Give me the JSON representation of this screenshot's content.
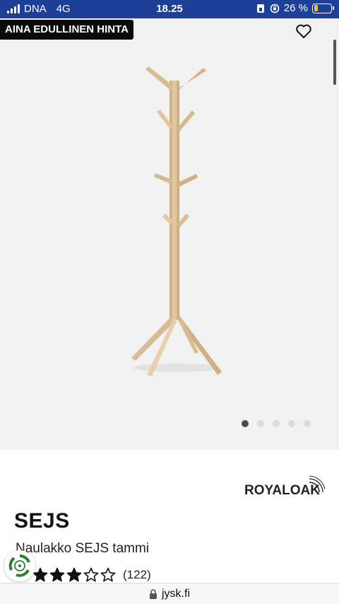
{
  "status_bar": {
    "carrier": "DNA",
    "network": "4G",
    "time": "18.25",
    "battery_percent_text": "26 %",
    "battery_level": 0.26,
    "battery_color": "#f5c400",
    "background_color": "#1d3f97"
  },
  "product_image": {
    "promo_badge": "AINA EDULLINEN HINTA",
    "favorite_icon": "heart-outline-icon",
    "carousel_total": 5,
    "carousel_active_index": 0
  },
  "product": {
    "brand": "ROYALOAK",
    "name": "SEJS",
    "description": "Naulakko SEJS tammi",
    "rating": 3,
    "rating_max": 5,
    "review_count": "(122)"
  },
  "browser": {
    "url": "jysk.fi",
    "lock_icon": "lock-icon"
  },
  "icons": {
    "eco": "recycle-badge-icon"
  }
}
